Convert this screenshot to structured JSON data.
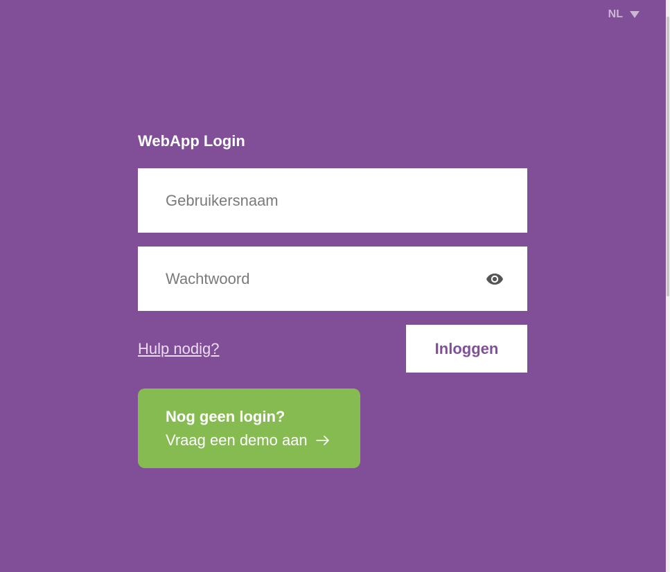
{
  "language": {
    "selected": "NL"
  },
  "login": {
    "title": "WebApp Login",
    "username_placeholder": "Gebruikersnaam",
    "password_placeholder": "Wachtwoord",
    "help_link": "Hulp nodig?",
    "submit_label": "Inloggen"
  },
  "demo": {
    "heading": "Nog geen login?",
    "link_label": "Vraag een demo aan"
  },
  "colors": {
    "background": "#804f97",
    "demo_green": "#86bb52",
    "field_bg": "#ffffff",
    "accent_text": "#804f97"
  },
  "icons": {
    "language_dropdown": "chevron-down-icon",
    "password_toggle": "eye-icon",
    "demo_arrow": "arrow-right-icon"
  }
}
